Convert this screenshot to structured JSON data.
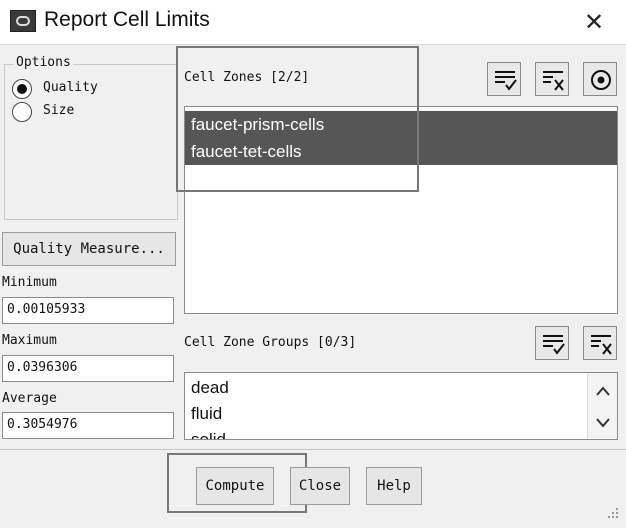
{
  "window": {
    "title": "Report Cell Limits",
    "close_glyph": "✕"
  },
  "options": {
    "legend": "Options",
    "radios": [
      {
        "label": "Quality",
        "selected": true
      },
      {
        "label": "Size",
        "selected": false
      }
    ]
  },
  "quality_measure_label": "Quality Measure...",
  "fields": {
    "minimum": {
      "label": "Minimum",
      "value": "0.00105933"
    },
    "maximum": {
      "label": "Maximum",
      "value": "0.0396306"
    },
    "average": {
      "label": "Average",
      "value": "0.3054976"
    }
  },
  "cell_zones": {
    "label": "Cell Zones [2/2]",
    "items": [
      {
        "label": "faucet-prism-cells",
        "selected": true
      },
      {
        "label": "faucet-tet-cells",
        "selected": true
      }
    ]
  },
  "cell_zone_groups": {
    "label": "Cell Zone Groups [0/3]",
    "items": [
      {
        "label": "dead",
        "selected": false
      },
      {
        "label": "fluid",
        "selected": false
      },
      {
        "label": "solid",
        "selected": false
      }
    ]
  },
  "buttons": {
    "compute": "Compute",
    "close": "Close",
    "help": "Help"
  },
  "icons": {
    "select_all": "select-all-icon",
    "deselect_all": "deselect-all-icon",
    "radio_target": "radio-target-icon",
    "scroll_up": "scroll-up-arrow-icon",
    "scroll_down": "scroll-down-arrow-icon",
    "resize_grip": "resize-grip-icon"
  }
}
